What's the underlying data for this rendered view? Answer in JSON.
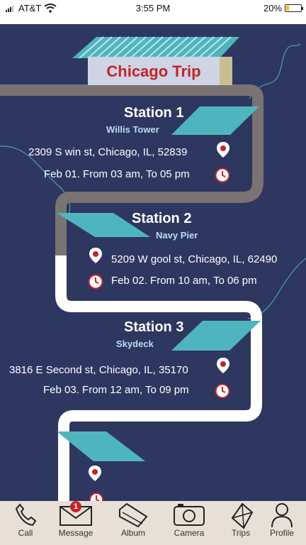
{
  "status": {
    "carrier": "AT&T",
    "time": "3:55 PM",
    "battery": "20%",
    "battery_level": 0.2
  },
  "title": "Chicago Trip",
  "stations": [
    {
      "name": "Station 1",
      "place": "Willis Tower",
      "address": "2309 S win st, Chicago, IL, 52839",
      "time": "Feb 01. From 03 am, To 05 pm"
    },
    {
      "name": "Station 2",
      "place": "Navy Pier",
      "address": "5209 W gool st, Chicago, IL, 62490",
      "time": "Feb 02. From 10 am, To 06 pm"
    },
    {
      "name": "Station 3",
      "place": "Skydeck",
      "address": "3816 E Second st, Chicago, IL, 35170",
      "time": "Feb 03. From 12 am, To 09 pm"
    }
  ],
  "tabs": [
    {
      "label": "Call",
      "icon": "phone-icon"
    },
    {
      "label": "Message",
      "icon": "envelope-icon",
      "badge": "1"
    },
    {
      "label": "Album",
      "icon": "folder-icon"
    },
    {
      "label": "Camera",
      "icon": "camera-icon"
    },
    {
      "label": "Trips",
      "icon": "kite-icon"
    },
    {
      "label": "Profile",
      "icon": "person-icon"
    }
  ],
  "colors": {
    "background": "#2e3760",
    "road_upper": "#7a7273",
    "road_lower": "#ffffff",
    "accent": "#4fb5bd",
    "title_red": "#c4232a"
  }
}
